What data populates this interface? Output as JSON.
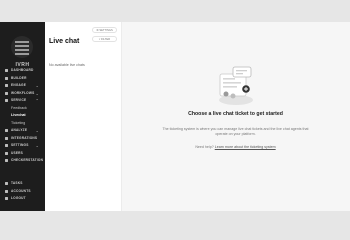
{
  "sidebar": {
    "brand": "IVRH",
    "items": [
      {
        "label": "DASHBOARD",
        "icon": "dashboard-icon"
      },
      {
        "label": "BUILDER",
        "icon": "builder-icon"
      },
      {
        "label": "ENGAGE",
        "icon": "engage-icon",
        "chevron": "⌄"
      },
      {
        "label": "WORKFLOWS",
        "icon": "workflows-icon",
        "chevron": "⌄"
      },
      {
        "label": "SERVICE",
        "icon": "service-icon",
        "chevron": "⌃"
      }
    ],
    "sub_items": [
      "Feedback",
      "Livechat",
      "Ticketing"
    ],
    "items_after": [
      {
        "label": "ANALYZE",
        "icon": "analyze-icon",
        "chevron": "⌄"
      },
      {
        "label": "INTEGRATIONS",
        "icon": "integrations-icon"
      },
      {
        "label": "SETTINGS",
        "icon": "settings-icon",
        "chevron": "⌄"
      },
      {
        "label": "USERS",
        "icon": "users-icon"
      },
      {
        "label": "CHECKERSTATION",
        "icon": "checker-icon"
      }
    ],
    "bottom": [
      {
        "label": "TASKS",
        "icon": "tasks-icon"
      },
      {
        "label": "ACCOUNTS",
        "icon": "accounts-icon"
      },
      {
        "label": "LOGOUT",
        "icon": "logout-icon"
      }
    ]
  },
  "list_panel": {
    "title": "Live chat",
    "settings_button": "SETTINGS",
    "filter_button": "FILTER",
    "empty": "No available live chats"
  },
  "main": {
    "title": "Choose a live chat ticket to get started",
    "description": "The ticketing system is where you can manage live chat tickets and the live chat agents that operate on your platform.",
    "help_prefix": "Need help?",
    "help_link": "Learn more about the ticketing system"
  },
  "colors": {
    "sidebar_bg": "#1d1d1d",
    "panel_bg": "#ffffff",
    "main_bg": "#f6f6f6"
  }
}
